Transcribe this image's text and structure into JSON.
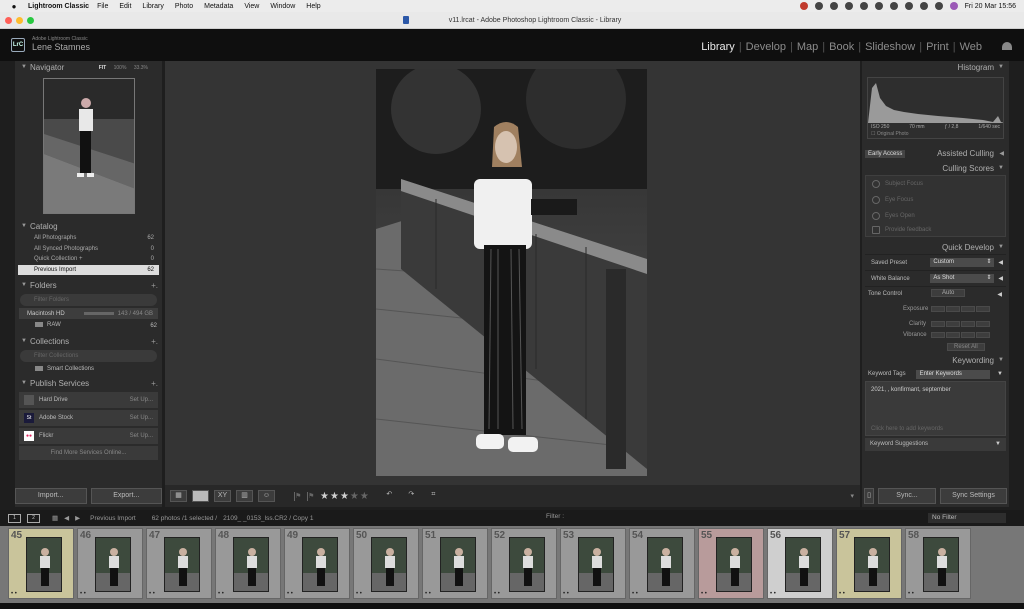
{
  "macos": {
    "app_name": "Lightroom Classic",
    "menu": [
      "File",
      "Edit",
      "Library",
      "Photo",
      "Metadata",
      "View",
      "Window",
      "Help"
    ],
    "clock": "Fri 20 Mar  15:56"
  },
  "window": {
    "title": "v11.lrcat - Adobe Photoshop Lightroom Classic - Library"
  },
  "identity": {
    "logo": "LrC",
    "product": "Adobe Lightroom Classic",
    "user": "Lene Stamnes"
  },
  "modules": [
    "Library",
    "Develop",
    "Map",
    "Book",
    "Slideshow",
    "Print",
    "Web"
  ],
  "active_module": "Library",
  "navigator": {
    "title": "Navigator",
    "zoom_options": [
      "FIT",
      "100%",
      "33.3%"
    ]
  },
  "catalog": {
    "title": "Catalog",
    "items": [
      {
        "label": "All Photographs",
        "count": "62"
      },
      {
        "label": "All Synced Photographs",
        "count": "0"
      },
      {
        "label": "Quick Collection +",
        "count": "0"
      },
      {
        "label": "Previous Import",
        "count": "62"
      }
    ]
  },
  "folders": {
    "title": "Folders",
    "filter_placeholder": "Filter Folders",
    "volume": {
      "name": "Macintosh HD",
      "space": "143 / 494 GB"
    },
    "items": [
      {
        "label": "RAW",
        "count": "62"
      }
    ]
  },
  "collections": {
    "title": "Collections",
    "filter_placeholder": "Filter Collections",
    "items": [
      {
        "label": "Smart Collections"
      }
    ]
  },
  "publish_services": {
    "title": "Publish Services",
    "items": [
      {
        "label": "Hard Drive",
        "action": "Set Up..."
      },
      {
        "label": "Adobe Stock",
        "action": "Set Up..."
      },
      {
        "label": "Flickr",
        "action": "Set Up..."
      }
    ],
    "find_more": "Find More Services Online..."
  },
  "left_buttons": {
    "import": "Import...",
    "export": "Export..."
  },
  "histogram": {
    "title": "Histogram",
    "iso": "ISO 250",
    "focal": "70 mm",
    "aperture": "ƒ / 2,8",
    "shutter": "1/640 sec",
    "original_photo": "Original Photo"
  },
  "assisted_culling": {
    "title": "Assisted Culling",
    "tab": "Early Access"
  },
  "culling_scores": {
    "title": "Culling Scores",
    "rows": [
      "Subject Focus",
      "Eye Focus",
      "Eyes Open",
      "Provide feedback"
    ]
  },
  "quick_develop": {
    "title": "Quick Develop",
    "saved_preset_label": "Saved Preset",
    "saved_preset_value": "Custom",
    "white_balance_label": "White Balance",
    "white_balance_value": "As Shot",
    "tone_control_label": "Tone Control",
    "auto": "Auto",
    "exposure": "Exposure",
    "clarity": "Clarity",
    "vibrance": "Vibrance",
    "reset_all": "Reset All"
  },
  "keywording": {
    "title": "Keywording",
    "tags_label": "Keyword Tags",
    "tags_value": "Enter Keywords",
    "keywords": "2021,         , konfirmant, september",
    "hint": "Click here to add keywords",
    "suggestions": "Keyword Suggestions"
  },
  "right_buttons": {
    "sync": "Sync...",
    "sync_settings": "Sync Settings"
  },
  "toolbar": {
    "rating": 3,
    "max_rating": 5
  },
  "filmstrip_bar": {
    "page1": "1",
    "page2": "2",
    "source": "Previous Import",
    "count": "62 photos /1 selected /",
    "filename": "2109_          _0153_lss.CR2 / Copy 1",
    "filter_label": "Filter :",
    "filter_value": "No Filter"
  },
  "filmstrip": {
    "cells": [
      {
        "num": "45",
        "state": "tint"
      },
      {
        "num": "46",
        "state": "normal"
      },
      {
        "num": "47",
        "state": "normal"
      },
      {
        "num": "48",
        "state": "normal"
      },
      {
        "num": "49",
        "state": "normal"
      },
      {
        "num": "50",
        "state": "normal"
      },
      {
        "num": "51",
        "state": "normal"
      },
      {
        "num": "52",
        "state": "normal"
      },
      {
        "num": "53",
        "state": "normal"
      },
      {
        "num": "54",
        "state": "normal"
      },
      {
        "num": "55",
        "state": "sel1"
      },
      {
        "num": "56",
        "state": "sel2"
      },
      {
        "num": "57",
        "state": "tint"
      },
      {
        "num": "58",
        "state": "normal"
      }
    ]
  },
  "colors": {
    "accent": "#e8e8e8",
    "panel": "#2b2b2b",
    "main": "#343434"
  }
}
